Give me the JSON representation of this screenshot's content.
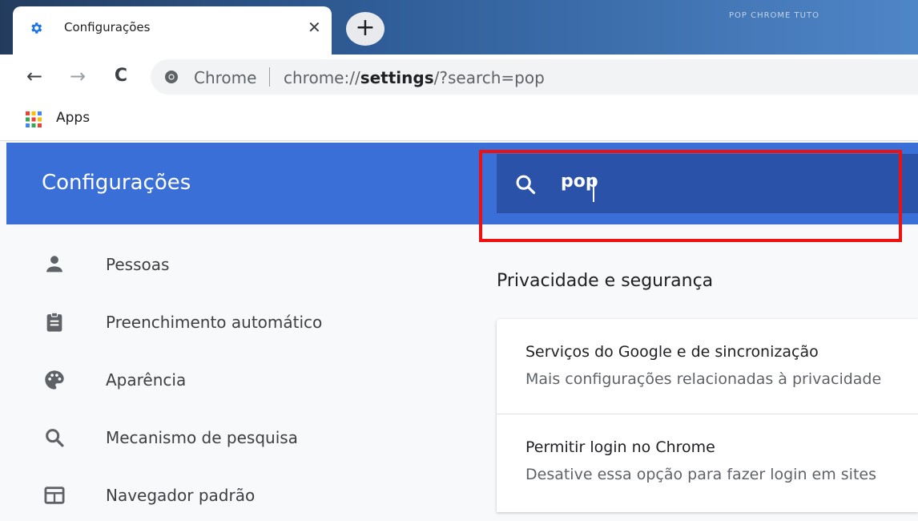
{
  "tab": {
    "title": "Configurações",
    "close_glyph": "✕",
    "favicon": "gear-icon"
  },
  "new_tab_glyph": "+",
  "tabstrip_right_text": "POP CHROME TUTO",
  "toolbar": {
    "back_glyph": "←",
    "forward_glyph": "→",
    "reload_glyph": "C",
    "omnibox_site": "Chrome",
    "url_prefix": "chrome://",
    "url_host": "settings",
    "url_rest": "/?search=pop"
  },
  "bookmarks": {
    "apps_label": "Apps"
  },
  "settings": {
    "title": "Configurações",
    "search_value": "pop"
  },
  "sidebar": {
    "items": [
      {
        "label": "Pessoas",
        "icon": "person-icon"
      },
      {
        "label": "Preenchimento automático",
        "icon": "clipboard-icon"
      },
      {
        "label": "Aparência",
        "icon": "palette-icon"
      },
      {
        "label": "Mecanismo de pesquisa",
        "icon": "search-icon"
      },
      {
        "label": "Navegador padrão",
        "icon": "browser-window-icon"
      }
    ]
  },
  "main": {
    "section_title": "Privacidade e segurança",
    "rows": [
      {
        "title": "Serviços do Google e de sincronização",
        "subtitle": "Mais configurações relacionadas à privacidade"
      },
      {
        "title": "Permitir login no Chrome",
        "subtitle": "Desative essa opção para fazer login em sites"
      }
    ]
  },
  "colors": {
    "header_blue": "#3a6fd8",
    "search_blue": "#2a52a8",
    "highlight_red": "#ee1111"
  }
}
